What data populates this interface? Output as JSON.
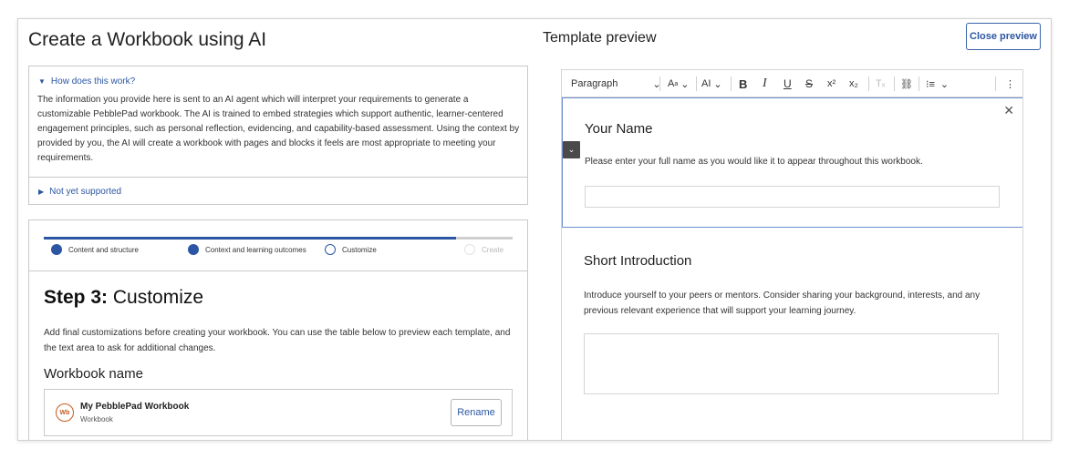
{
  "page": {
    "title": "Create a Workbook using AI"
  },
  "preview": {
    "title": "Template preview",
    "close_label": "Close preview",
    "toolbar": {
      "paragraph": "Paragraph",
      "chevron": "⌄",
      "font_size": "A",
      "font_size_sup": "a",
      "ai": "AI",
      "bold": "B",
      "italic": "I",
      "underline": "U",
      "strike": "S",
      "superscript": "x²",
      "subscript": "x₂",
      "clear": "Tₓ",
      "link": "⛓",
      "list": "⁝≡",
      "more": "⋮"
    },
    "blocks": [
      {
        "title": "Your Name",
        "text": "Please enter your full name as you would like it to appear throughout this workbook."
      },
      {
        "title": "Short Introduction",
        "text": "Introduce yourself to your peers or mentors. Consider sharing your background, interests, and any previous relevant experience that will support your learning journey."
      }
    ],
    "close_block_glyph": "✕",
    "collapse_glyph": "⌄"
  },
  "accordion": {
    "item1": {
      "label": "How does this work?",
      "body": "The information you provide here is sent to an AI agent which will interpret your requirements to generate a customizable PebblePad workbook. The AI is trained to embed strategies which support authentic, learner-centered engagement principles, such as personal reflection, evidencing, and capability-based assessment. Using the context by provided by you, the AI will create a workbook with pages and blocks it feels are most appropriate to meeting your requirements."
    },
    "item2": {
      "label": "Not yet supported"
    },
    "expanded_glyph": "▼",
    "collapsed_glyph": "▶"
  },
  "wizard": {
    "progress": 0.88,
    "steps": [
      {
        "label": "Content and structure",
        "state": "done"
      },
      {
        "label": "Context and learning outcomes",
        "state": "done"
      },
      {
        "label": "Customize",
        "state": "current"
      },
      {
        "label": "Create",
        "state": "disabled"
      }
    ],
    "heading_bold": "Step 3:",
    "heading_rest": " Customize",
    "description": "Add final customizations before creating your workbook. You can use the table below to preview each template, and the text area to ask for additional changes.",
    "workbook_label": "Workbook name",
    "workbook": {
      "icon_text": "Wb",
      "name": "My PebblePad Workbook",
      "type": "Workbook",
      "rename_label": "Rename"
    }
  },
  "colors": {
    "accent": "#2c56a3",
    "brand_orange": "#c65a1e",
    "focus_border": "#6c8fd0"
  }
}
